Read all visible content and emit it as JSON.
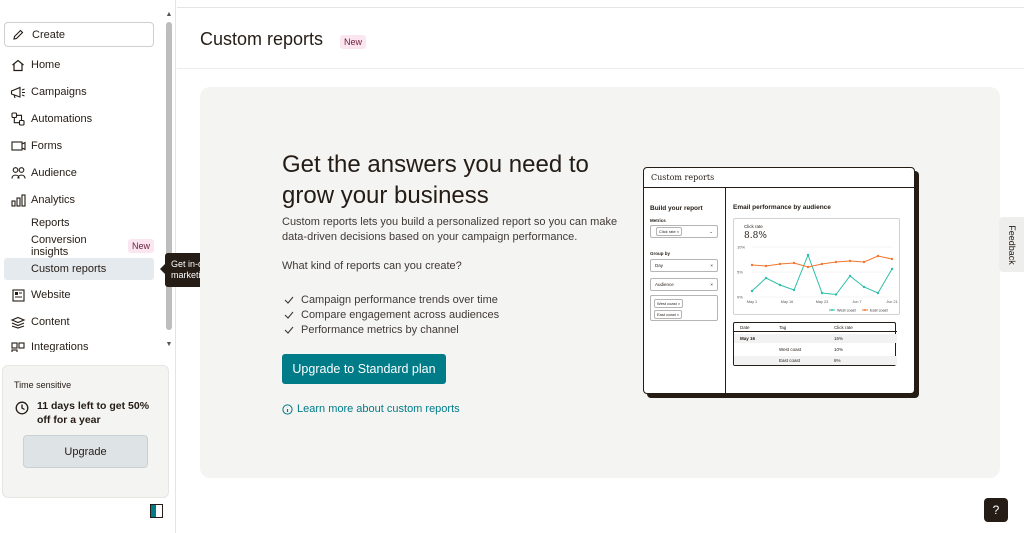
{
  "sidebar": {
    "create_label": "Create",
    "items": [
      {
        "label": "Home",
        "icon": "home-icon"
      },
      {
        "label": "Campaigns",
        "icon": "megaphone-icon"
      },
      {
        "label": "Automations",
        "icon": "automation-icon"
      },
      {
        "label": "Forms",
        "icon": "forms-icon"
      },
      {
        "label": "Audience",
        "icon": "audience-icon"
      },
      {
        "label": "Analytics",
        "icon": "analytics-icon"
      }
    ],
    "analytics_sub": {
      "reports": "Reports",
      "conversion": "Conversion insights",
      "conversion_badge": "New",
      "custom": "Custom reports"
    },
    "items_after": [
      {
        "label": "Website",
        "icon": "website-icon"
      },
      {
        "label": "Content",
        "icon": "content-icon"
      },
      {
        "label": "Integrations",
        "icon": "integrations-icon"
      }
    ],
    "time_card": {
      "label": "Time sensitive",
      "message": "11 days left to get 50% off for a year",
      "button": "Upgrade"
    }
  },
  "tooltip": "Get in-depth analysis of your marketing performance",
  "page": {
    "title": "Custom reports",
    "badge": "New"
  },
  "hero": {
    "heading": "Get the answers you need to grow your business",
    "description": "Custom reports lets you build a personalized report so you can make data-driven decisions based on your campaign performance.",
    "question": "What kind of reports can you create?",
    "bullets": [
      "Campaign performance trends over time",
      "Compare engagement across audiences",
      "Performance metrics by channel"
    ],
    "cta": "Upgrade to Standard plan",
    "learn_more": "Learn more about custom reports"
  },
  "illustration": {
    "header": "Custom reports",
    "build_title": "Build your report",
    "metrics_label": "Metrics",
    "metrics_chip": "Click rate",
    "group_label": "Group by",
    "group_value": "Day",
    "audience_label": "Audience",
    "audience_chips": [
      "West coast",
      "East coast"
    ],
    "chart_title": "Email performance by audience",
    "chart_metric": "Click rate",
    "chart_value": "8.8%",
    "legend": [
      "West coast",
      "East coast"
    ],
    "table_headers": [
      "Date",
      "Tag",
      "Click rate"
    ],
    "table_rows": [
      {
        "date": "May 16",
        "tag": "",
        "rate": "16%"
      },
      {
        "date": "",
        "tag": "West coast",
        "rate": "10%"
      },
      {
        "date": "",
        "tag": "East coast",
        "rate": "6%"
      }
    ]
  },
  "chart_data": {
    "type": "line",
    "title": "Email performance by audience",
    "x_ticks": [
      "May 1",
      "May 16",
      "May 23",
      "Jun 7",
      "Jun 21"
    ],
    "y_ticks": [
      "10%",
      "5%",
      "0%"
    ],
    "ylim": [
      0,
      10
    ],
    "series": [
      {
        "name": "West coast",
        "color": "#2fbfa8",
        "values": [
          1.2,
          3.8,
          2.4,
          1.4,
          8.4,
          0.8,
          0.5,
          4.2,
          2.0,
          0.8,
          5.6
        ]
      },
      {
        "name": "East coast",
        "color": "#f0772f",
        "values": [
          6.4,
          6.2,
          6.6,
          6.8,
          6.0,
          6.6,
          7.0,
          7.2,
          7.0,
          8.2,
          7.6
        ]
      }
    ]
  },
  "feedback": "Feedback",
  "help": "?"
}
